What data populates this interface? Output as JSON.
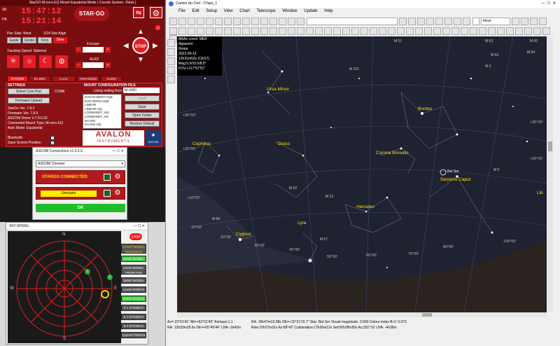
{
  "stargo": {
    "title": "StarGO  M-zero-EQ Mount Equatorial Mode  ( Coords System: JNow )",
    "lst_label": "SK",
    "lst": "15:47:12",
    "ra_label": "HK",
    "ra": "15:21:14",
    "logo": "STAR·GO",
    "pier_side": "Pier Side: West",
    "align": "2/24 Star Align",
    "mode_buttons": [
      "Guide",
      "Center",
      "Find",
      "Slew"
    ],
    "tracking": "Tracking Speed: Sidereal",
    "focuser": "Focuser",
    "aux2": "AUX2",
    "stop": "STOP",
    "tabs": [
      "SYSTEM",
      "RA DEC",
      "A.U.X.",
      "ADVANCED",
      "ALIGN"
    ],
    "settings_title": "SETTINGS",
    "com_select": "Select Com Port",
    "com_value": "COM6",
    "firmware": "Firmware Upload",
    "info_lines": [
      "StarGo Ver. 7.8.3",
      "Firmware Ver. 7.8.6",
      "ASCOM Driver V.7.0.0.32",
      "Connected Mount Type: M-zero-EQ",
      "Auto Mode: Equatorial"
    ],
    "bluetooth": "Bluetooth",
    "save_screen": "Save Screen Position",
    "mount_config_title": "MOUNT CONFIGURATION FILE",
    "using_setting": "Using setting from",
    "setting_value": "M-UNO",
    "config_list": [
      "EVO-M-ZERO-HQZ",
      "EVO-ZERO-HQE",
      "LINEAR",
      "LINEAR-HQ",
      "LOSMANDY_HQ",
      "LOSMANDY_HS",
      "M-UNO",
      "M-UNO-HQ"
    ],
    "config_buttons": [
      "Load",
      "Save",
      "Open Folder",
      "Restore Default"
    ],
    "avalon": "AVALON",
    "instruments": "INSTRUMENTS",
    "ascom_logo": "ASCOM"
  },
  "ascom": {
    "title": "ASCOM Connections v1.6.5.3",
    "chooser": "ASCOM Chooser",
    "stargo_connected": "STARGO CONNECTED",
    "simulator": "Simulator",
    "ok": "OK"
  },
  "sky_model": {
    "title": "SKY MODEL",
    "compass": {
      "n": "N",
      "s": "S",
      "e": "E",
      "w": "W"
    },
    "points": [
      "1",
      "2"
    ],
    "stop": "STOP",
    "buttons": [
      {
        "label": "START MODEL SEQUENCE",
        "green": false
      },
      {
        "label": "SAVE MODEL",
        "green": true
      },
      {
        "label": "LOAD MODEL FROM FILE",
        "green": false
      },
      {
        "label": "SEND MODEL",
        "green": false
      },
      {
        "label": "LOAD POINTS",
        "green": false
      },
      {
        "label": "SAVE POINTS",
        "green": true
      },
      {
        "label": "3 × 3 POINTS",
        "green": false
      },
      {
        "label": "5 × 5 POINTS",
        "green": false
      },
      {
        "label": "8 × 8 POINTS",
        "green": false
      },
      {
        "label": "CLEAR POINTS",
        "green": false
      }
    ]
  },
  "cdc": {
    "title": "Cartes du Ciel - Chart_1",
    "menu": [
      "File",
      "Edit",
      "Setup",
      "View",
      "Chart",
      "Telescope",
      "Window",
      "Update",
      "Help"
    ],
    "hour_select": "Hour",
    "info_box": [
      "Alt/Az coord. MER",
      "Apparent",
      "Roma",
      "2022-09-13",
      "12h31m52s (CEST)",
      "Mag:5.9/10.5/8.0°",
      "FOV:+117°57'51\""
    ],
    "constellations": [
      {
        "name": "Ursa Minor"
      },
      {
        "name": "Bootes"
      },
      {
        "name": "Cepheus"
      },
      {
        "name": "Draco"
      },
      {
        "name": "Corona Borealis"
      },
      {
        "name": "Serpens Caput"
      },
      {
        "name": "Hercules"
      },
      {
        "name": "Lyra"
      },
      {
        "name": "Cygnus"
      },
      {
        "name": "Lib"
      }
    ],
    "objects": [
      "M 101",
      "M 51",
      "M 63",
      "M 3",
      "M 53",
      "M 5",
      "M 92",
      "M 13",
      "M 57",
      "M 56",
      "M 64",
      "M 60",
      "Bet Ser"
    ],
    "grid_labels": [
      "+30°00'",
      "+20°00'",
      "+10°00'",
      "10°00'",
      "20°00'",
      "30°00'",
      "40°00'",
      "50°00'",
      "60°00'",
      "70°00'",
      "80°00'",
      "100°00'",
      "+30°00'",
      "+20°00'"
    ],
    "status1": "Az=-22°01'41\"  Alt=+62°01'40\"  Airmass:1.1",
    "status2": "RA: 12h33m35.6s  DE=+65°45'44\"  LHA:-1h42m",
    "status3": "RA: 15h47m13.08s  DE=+15°21'16.7\"   Star: Bet Ser  Visual magnitude: 3.650  Colour index B-V: 0.073",
    "status4": "Rise:10h27m31s Az:68°42'   Culmination:17h26m12s  Set:00h28m50s  Az:291°16'  LHA: -4h36m"
  }
}
